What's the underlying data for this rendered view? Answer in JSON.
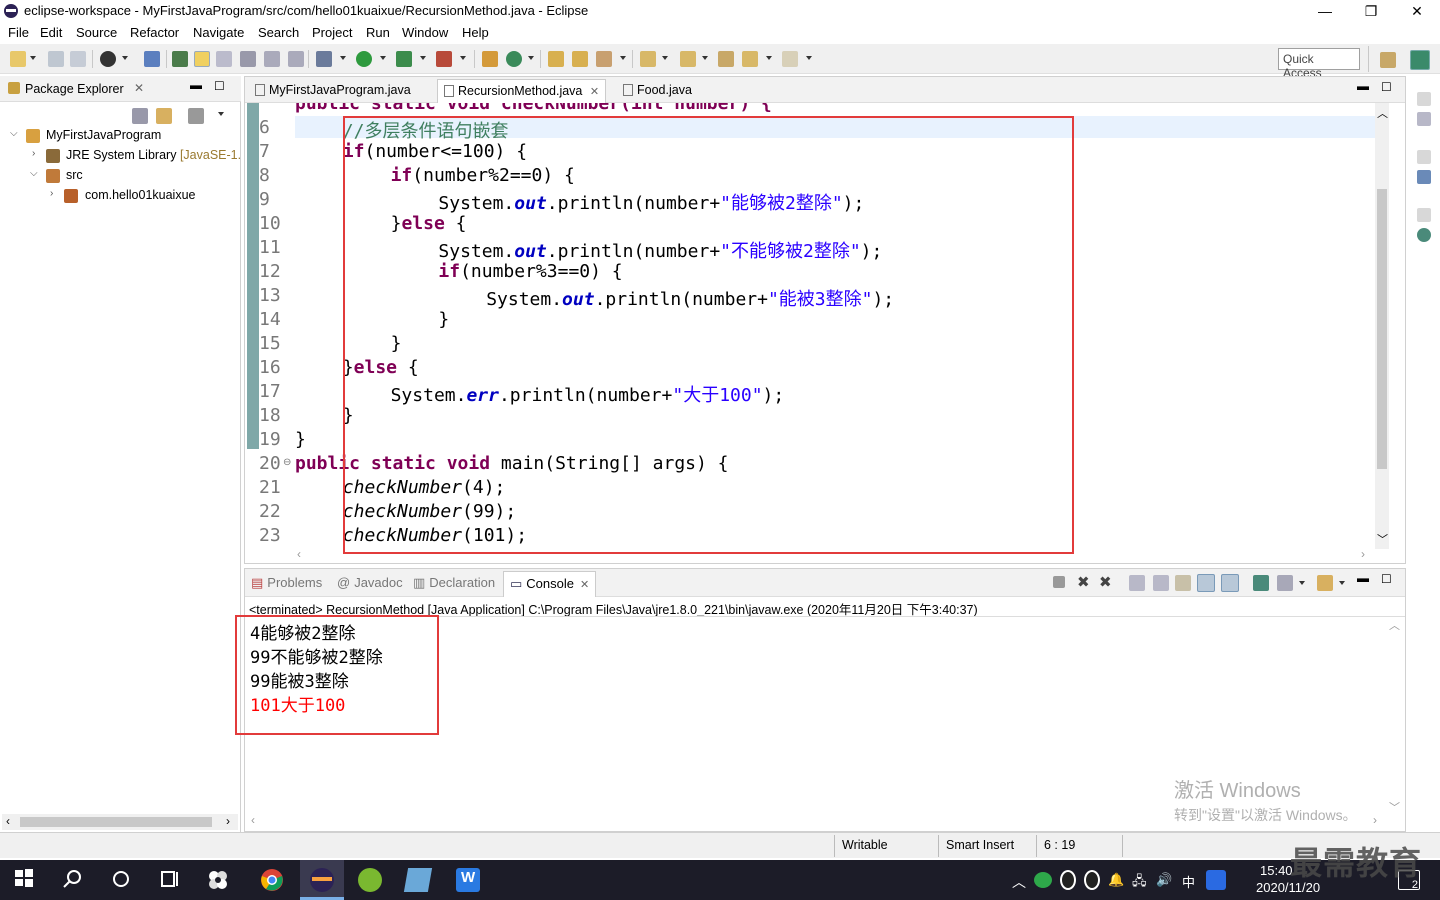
{
  "window": {
    "title": "eclipse-workspace - MyFirstJavaProgram/src/com/hello01kuaixue/RecursionMethod.java - Eclipse",
    "minimize": "—",
    "restore": "❐",
    "close": "✕"
  },
  "menu": [
    "File",
    "Edit",
    "Source",
    "Refactor",
    "Navigate",
    "Search",
    "Project",
    "Run",
    "Window",
    "Help"
  ],
  "toolbar": {
    "quick_access_placeholder": "Quick Access"
  },
  "package_explorer": {
    "tab_label": "Package Explorer",
    "tree": [
      {
        "label": "MyFirstJavaProgram",
        "expanded": true
      },
      {
        "label": "JRE System Library",
        "suffix": "[JavaSE-1."
      },
      {
        "label": "src",
        "expanded": true
      },
      {
        "label": "com.hello01kuaixue"
      }
    ]
  },
  "editor": {
    "tabs": [
      {
        "label": "MyFirstJavaProgram.java",
        "active": false
      },
      {
        "label": "RecursionMethod.java",
        "active": true
      },
      {
        "label": "Food.java",
        "active": false
      }
    ],
    "partial_top_line": "public static void checkNumber(int number) {",
    "lines": [
      {
        "num": "6",
        "indent": 2,
        "tokens": [
          {
            "t": "//多层条件语句嵌套",
            "c": "cm"
          }
        ]
      },
      {
        "num": "7",
        "indent": 2,
        "tokens": [
          {
            "t": "if",
            "c": "kw"
          },
          {
            "t": "(number<=100) {",
            "c": ""
          }
        ]
      },
      {
        "num": "8",
        "indent": 4,
        "tokens": [
          {
            "t": "if",
            "c": "kw"
          },
          {
            "t": "(number%2==0) {",
            "c": ""
          }
        ]
      },
      {
        "num": "9",
        "indent": 6,
        "tokens": [
          {
            "t": "System.",
            "c": ""
          },
          {
            "t": "out",
            "c": "fld"
          },
          {
            "t": ".println(number+",
            "c": ""
          },
          {
            "t": "\"能够被2整除\"",
            "c": "str"
          },
          {
            "t": ");",
            "c": ""
          }
        ]
      },
      {
        "num": "10",
        "indent": 4,
        "tokens": [
          {
            "t": "}",
            "c": ""
          },
          {
            "t": "else",
            "c": "kw"
          },
          {
            "t": " {",
            "c": ""
          }
        ]
      },
      {
        "num": "11",
        "indent": 6,
        "tokens": [
          {
            "t": "System.",
            "c": ""
          },
          {
            "t": "out",
            "c": "fld"
          },
          {
            "t": ".println(number+",
            "c": ""
          },
          {
            "t": "\"不能够被2整除\"",
            "c": "str"
          },
          {
            "t": ");",
            "c": ""
          }
        ]
      },
      {
        "num": "12",
        "indent": 6,
        "tokens": [
          {
            "t": "if",
            "c": "kw"
          },
          {
            "t": "(number%3==0) {",
            "c": ""
          }
        ]
      },
      {
        "num": "13",
        "indent": 8,
        "tokens": [
          {
            "t": "System.",
            "c": ""
          },
          {
            "t": "out",
            "c": "fld"
          },
          {
            "t": ".println(number+",
            "c": ""
          },
          {
            "t": "\"能被3整除\"",
            "c": "str"
          },
          {
            "t": ");",
            "c": ""
          }
        ]
      },
      {
        "num": "14",
        "indent": 6,
        "tokens": [
          {
            "t": "}",
            "c": ""
          }
        ]
      },
      {
        "num": "15",
        "indent": 4,
        "tokens": [
          {
            "t": "}",
            "c": ""
          }
        ]
      },
      {
        "num": "16",
        "indent": 2,
        "tokens": [
          {
            "t": "}",
            "c": ""
          },
          {
            "t": "else",
            "c": "kw"
          },
          {
            "t": " {",
            "c": ""
          }
        ]
      },
      {
        "num": "17",
        "indent": 4,
        "tokens": [
          {
            "t": "System.",
            "c": ""
          },
          {
            "t": "err",
            "c": "fld"
          },
          {
            "t": ".println(number+",
            "c": ""
          },
          {
            "t": "\"大于100\"",
            "c": "str"
          },
          {
            "t": ");",
            "c": ""
          }
        ]
      },
      {
        "num": "18",
        "indent": 2,
        "tokens": [
          {
            "t": "}",
            "c": ""
          }
        ]
      },
      {
        "num": "19",
        "indent": 0,
        "tokens": [
          {
            "t": "}",
            "c": ""
          }
        ]
      },
      {
        "num": "20",
        "indent": 0,
        "tokens": [
          {
            "t": "public static void",
            "c": "kw"
          },
          {
            "t": " main(String[] ",
            "c": ""
          },
          {
            "t": "args",
            "c": ""
          },
          {
            "t": ") {",
            "c": ""
          }
        ]
      },
      {
        "num": "21",
        "indent": 2,
        "tokens": [
          {
            "t": "checkNumber",
            "c": "ital"
          },
          {
            "t": "(4);",
            "c": ""
          }
        ]
      },
      {
        "num": "22",
        "indent": 2,
        "tokens": [
          {
            "t": "checkNumber",
            "c": "ital"
          },
          {
            "t": "(99);",
            "c": ""
          }
        ]
      },
      {
        "num": "23",
        "indent": 2,
        "tokens": [
          {
            "t": "checkNumber",
            "c": "ital"
          },
          {
            "t": "(101);",
            "c": ""
          }
        ]
      }
    ]
  },
  "console": {
    "tabs": [
      "Problems",
      "Javadoc",
      "Declaration",
      "Console"
    ],
    "active_tab": "Console",
    "header": "<terminated> RecursionMethod [Java Application] C:\\Program Files\\Java\\jre1.8.0_221\\bin\\javaw.exe (2020年11月20日 下午3:40:37)",
    "output": [
      {
        "text": "4能够被2整除",
        "stream": "out"
      },
      {
        "text": "99不能够被2整除",
        "stream": "out"
      },
      {
        "text": "99能被3整除",
        "stream": "out"
      },
      {
        "text": "101大于100",
        "stream": "err"
      }
    ]
  },
  "statusbar": {
    "mode": "Writable",
    "insert": "Smart Insert",
    "position": "6 : 19"
  },
  "watermark": {
    "line1": "激活 Windows",
    "line2": "转到\"设置\"以激活 Windows。"
  },
  "brand": "最需教育",
  "taskbar": {
    "time": "15:40",
    "date": "2020/11/20",
    "ime": "中",
    "notif_count": "2"
  },
  "colors": {
    "keyword": "#7f0055",
    "string": "#2a00ff",
    "comment": "#3f7f5f",
    "field": "#0000c0",
    "err": "#ff0000",
    "highlight_box": "#e23b3b"
  }
}
